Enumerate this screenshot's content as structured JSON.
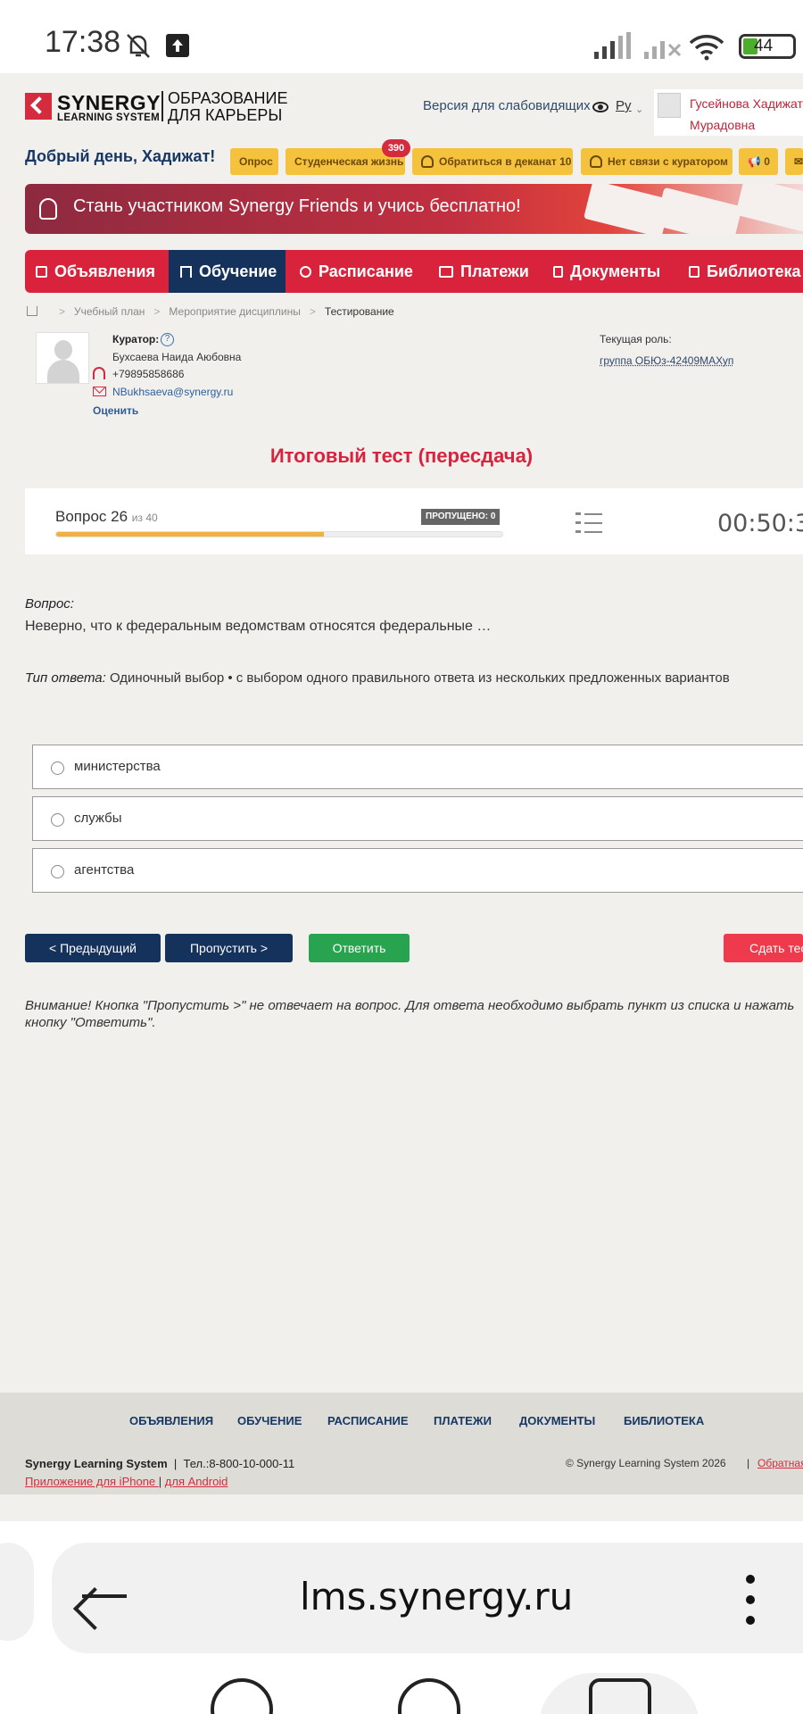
{
  "status_bar": {
    "time": "17:38",
    "battery": "44"
  },
  "header": {
    "logo_name": "SYNERGY",
    "logo_sub": "LEARNING SYSTEM",
    "logo_tag_line1": "ОБРАЗОВАНИЕ",
    "logo_tag_line2": "ДЛЯ КАРЬЕРЫ",
    "vision_link": "Версия для слабовидящих",
    "language": "Ру",
    "user_name_line1": "Гусейнова Хадижат",
    "user_name_line2": "Мурадовна"
  },
  "greeting": "Добрый день, Хадижат!",
  "quick_links": [
    {
      "label": "Опрос"
    },
    {
      "label": "Студенческая жизнь",
      "badge": "390"
    },
    {
      "label": "Обратиться в деканат 10"
    },
    {
      "label": "Нет связи с куратором"
    },
    {
      "label": "0"
    }
  ],
  "banner_text": "Стань участником Synergy Friends и учись бесплатно!",
  "nav": [
    {
      "label": "Объявления",
      "active": false
    },
    {
      "label": "Обучение",
      "active": true
    },
    {
      "label": "Расписание",
      "active": false
    },
    {
      "label": "Платежи",
      "active": false
    },
    {
      "label": "Документы",
      "active": false
    },
    {
      "label": "Библиотека",
      "active": false
    }
  ],
  "breadcrumb": [
    "Учебный план",
    "Мероприятие дисциплины",
    "Тестирование"
  ],
  "curator": {
    "title": "Куратор:",
    "name": "Бухсаева Наида Аюбовна",
    "phone": "+79895858686",
    "email": "NBukhsaeva@synergy.ru",
    "rate": "Оценить"
  },
  "role": {
    "title": "Текущая роль:",
    "group": "группа ОБЮз-42409МАХуп"
  },
  "test": {
    "title": "Итоговый тест (пересдача)",
    "question_label": "Вопрос 26",
    "question_of": "из 40",
    "skipped": "ПРОПУЩЕНО: 0",
    "progress": 0.6,
    "timer": "00:50:3"
  },
  "question": {
    "caption": "Вопрос:",
    "text": "Неверно, что к федеральным ведомствам относятся федеральные …",
    "type_caption": "Тип ответа:",
    "type_text": " Одиночный выбор • с выбором одного правильного ответа из нескольких предложенных вариантов",
    "options": [
      "министерства",
      "службы",
      "агентства"
    ]
  },
  "buttons": {
    "prev": "< Предыдущий",
    "skip": "Пропустить >",
    "answer": "Ответить",
    "finish": "Сдать тест"
  },
  "warning_line1": "Внимание! Кнопка \"Пропустить >\" не отвечает на вопрос. Для ответа необходимо выбрать пункт из списка и нажать",
  "warning_line2": "кнопку \"Ответить\".",
  "footer": {
    "links": [
      "ОБЪЯВЛЕНИЯ",
      "ОБУЧЕНИЕ",
      "РАСПИСАНИЕ",
      "ПЛАТЕЖИ",
      "ДОКУМЕНТЫ",
      "БИБЛИОТЕКА"
    ],
    "brand": "Synergy Learning System",
    "phone": "Тел.:8-800-10-000-11",
    "iphone": "Приложение для iPhone ",
    "android": "для Android",
    "copyright": "© Synergy Learning System 2026",
    "feedback": "Обратная"
  },
  "browser": {
    "url": "lms.synergy.ru"
  },
  "colors": {
    "brand_red": "#d9233d",
    "navy": "#15325d",
    "green": "#28a34f",
    "accent_yellow": "#f5c23e"
  }
}
